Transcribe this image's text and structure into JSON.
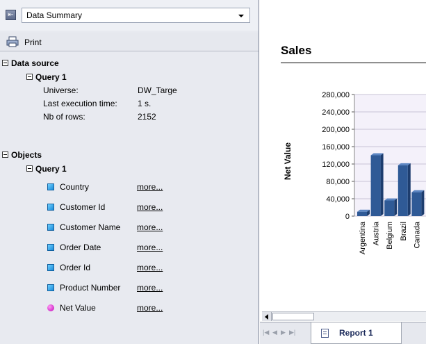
{
  "panel": {
    "dropdown_value": "Data Summary",
    "print_label": "Print"
  },
  "data_source": {
    "header": "Data source",
    "query": "Query 1",
    "fields": [
      {
        "label": "Universe:",
        "value": "DW_Targe"
      },
      {
        "label": "Last execution time:",
        "value": "1 s."
      },
      {
        "label": "Nb of rows:",
        "value": "2152"
      }
    ]
  },
  "objects": {
    "header": "Objects",
    "query": "Query 1",
    "more_label": "more...",
    "items": [
      {
        "name": "Country",
        "kind": "dimension"
      },
      {
        "name": "Customer Id",
        "kind": "dimension"
      },
      {
        "name": "Customer Name",
        "kind": "dimension"
      },
      {
        "name": "Order Date",
        "kind": "dimension"
      },
      {
        "name": "Order Id",
        "kind": "dimension"
      },
      {
        "name": "Product Number",
        "kind": "dimension"
      },
      {
        "name": "Net Value",
        "kind": "measure"
      }
    ]
  },
  "report": {
    "title": "Sales",
    "tab_label": "Report 1"
  },
  "colors": {
    "bar": "#2f5a96",
    "bar_top": "#5b85c2",
    "panel_bg": "#e8eaf0"
  },
  "chart_data": {
    "type": "bar",
    "ylabel": "Net Value",
    "xlabel": "",
    "ylim": [
      0,
      280000
    ],
    "y_ticks": [
      "280,000",
      "240,000",
      "200,000",
      "160,000",
      "120,000",
      "80,000",
      "40,000",
      "0"
    ],
    "categories": [
      "Argentina",
      "Austria",
      "Belgium",
      "Brazil",
      "Canada"
    ],
    "values": [
      10000,
      140000,
      36000,
      117000,
      55000
    ]
  }
}
